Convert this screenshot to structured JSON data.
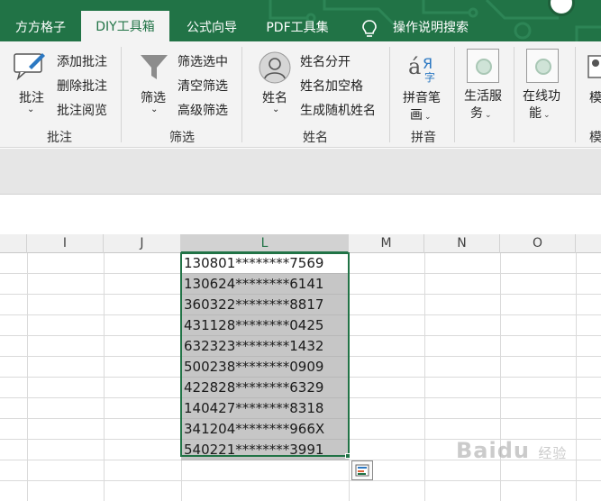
{
  "tabs": [
    {
      "label": "方方格子",
      "active": false
    },
    {
      "label": "DIY工具箱",
      "active": true
    },
    {
      "label": "公式向导",
      "active": false
    },
    {
      "label": "PDF工具集",
      "active": false
    },
    {
      "label": "操作说明搜索",
      "active": false
    }
  ],
  "ribbon": {
    "annotate": {
      "big_label": "批注",
      "items": [
        "添加批注",
        "删除批注",
        "批注阅览"
      ],
      "group_label": "批注"
    },
    "filter": {
      "big_label": "筛选",
      "items": [
        "筛选选中",
        "清空筛选",
        "高级筛选"
      ],
      "group_label": "筛选"
    },
    "name": {
      "big_label": "姓名",
      "items": [
        "姓名分开",
        "姓名加空格",
        "生成随机姓名"
      ],
      "group_label": "姓名"
    },
    "pinyin": {
      "big_label_line1": "拼音笔",
      "big_label_line2": "画",
      "group_label": "拼音"
    },
    "life_service": {
      "line1": "生活服",
      "line2": "务"
    },
    "online_func": {
      "line1": "在线功",
      "line2": "能"
    },
    "cut_item": "模",
    "cut_group": "模"
  },
  "columns": [
    {
      "label": "I",
      "selected": false
    },
    {
      "label": "J",
      "selected": false
    },
    {
      "label": "L",
      "selected": true
    },
    {
      "label": "M",
      "selected": false
    },
    {
      "label": "N",
      "selected": false
    },
    {
      "label": "O",
      "selected": false
    }
  ],
  "cells": [
    "130801********7569",
    "130624********6141",
    "360322********8817",
    "431128********0425",
    "632323********1432",
    "500238********0909",
    "422828********6329",
    "140427********8318",
    "341204********966X",
    "540221********3991"
  ],
  "watermark": {
    "brand": "Baidu",
    "suffix": "经验"
  },
  "colors": {
    "accent": "#217346",
    "selection_fill": "#c6c6c6"
  }
}
